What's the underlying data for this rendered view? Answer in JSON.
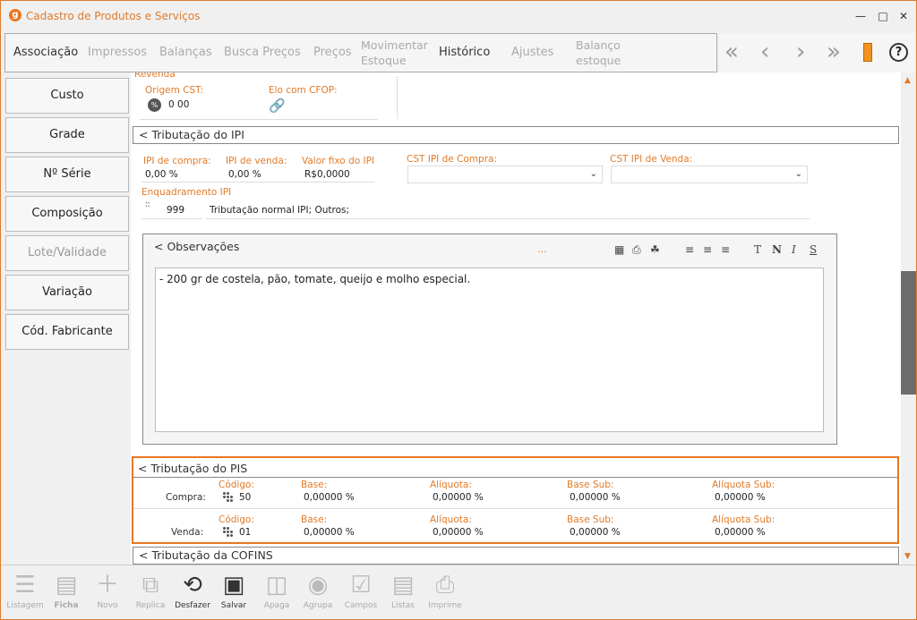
{
  "window": {
    "title": "Cadastro de Produtos e Serviços",
    "logo": "g"
  },
  "toolbar": {
    "tabs": [
      {
        "label": "Associação",
        "active": true
      },
      {
        "label": "Impressos",
        "active": false
      },
      {
        "label": "Balanças",
        "active": false
      },
      {
        "label": "Busca Preços",
        "active": false
      },
      {
        "label": "Preços",
        "active": false
      },
      {
        "label": "Movimentar Estoque",
        "active": false
      },
      {
        "label": "Histórico",
        "active": true
      },
      {
        "label": "Ajustes",
        "active": false
      },
      {
        "label": "Balanço estoque",
        "active": false
      }
    ],
    "help": "?"
  },
  "sidebar": {
    "items": [
      {
        "label": "Custo"
      },
      {
        "label": "Grade"
      },
      {
        "label": "Nº Série"
      },
      {
        "label": "Composição"
      },
      {
        "label": "Lote/Validade"
      },
      {
        "label": "Variação"
      },
      {
        "label": "Cód. Fabricante"
      }
    ]
  },
  "revenda": {
    "header": "Revenda",
    "origem_cst_label": "Origem CST:",
    "origem_cst_value": "0 00",
    "elo_cfop_label": "Elo com CFOP:"
  },
  "ipi": {
    "header": "< Tributação do IPI",
    "ipi_compra_label": "IPI de compra:",
    "ipi_compra_value": "0,00 %",
    "ipi_venda_label": "IPI de venda:",
    "ipi_venda_value": "0,00 %",
    "valor_fixo_label": "Valor fixo do IPI",
    "valor_fixo_value": "R$0,0000",
    "cst_compra_label": "CST IPI de Compra:",
    "cst_venda_label": "CST IPI de Venda:",
    "enquadramento_label": "Enquadramento IPI",
    "enquadramento_code": "999",
    "enquadramento_desc": "Tributação normal IPI; Outros;"
  },
  "observacoes": {
    "header": "< Observações",
    "ellipsis": "...",
    "text": "- 200 gr de costela, pão, tomate, queijo e molho especial."
  },
  "pis": {
    "header": "< Tributação do PIS",
    "rows": [
      {
        "label": "Compra:",
        "codigo_label": "Código:",
        "codigo": "50",
        "base_label": "Base:",
        "base": "0,00000 %",
        "aliquota_label": "Alíquota:",
        "aliquota": "0,00000 %",
        "base_sub_label": "Base Sub:",
        "base_sub": "0,00000 %",
        "aliquota_sub_label": "Alíquota Sub:",
        "aliquota_sub": "0,00000 %"
      },
      {
        "label": "Venda:",
        "codigo_label": "Código:",
        "codigo": "01",
        "base_label": "Base:",
        "base": "0,00000 %",
        "aliquota_label": "Alíquota:",
        "aliquota": "0,00000 %",
        "base_sub_label": "Base Sub:",
        "base_sub": "0,00000 %",
        "aliquota_sub_label": "Alíquota Sub:",
        "aliquota_sub": "0,00000 %"
      }
    ]
  },
  "cofins": {
    "header": "< Tributação da COFINS"
  },
  "bottom": {
    "items": [
      {
        "label": "Listagem",
        "icon": "list-icon",
        "on": false
      },
      {
        "label": "Ficha",
        "icon": "document-icon",
        "on": false
      },
      {
        "label": "Novo",
        "icon": "plus-icon",
        "on": false
      },
      {
        "label": "Replica",
        "icon": "copy-icon",
        "on": false
      },
      {
        "label": "Desfazer",
        "icon": "undo-icon",
        "on": true
      },
      {
        "label": "Salvar",
        "icon": "save-icon",
        "on": true
      },
      {
        "label": "Apaga",
        "icon": "trash-icon",
        "on": false
      },
      {
        "label": "Agrupa",
        "icon": "group-icon",
        "on": false
      },
      {
        "label": "Campos",
        "icon": "checklist-icon",
        "on": false
      },
      {
        "label": "Listas",
        "icon": "lists-icon",
        "on": false
      },
      {
        "label": "Imprime",
        "icon": "printer-icon",
        "on": false
      }
    ]
  },
  "colors": {
    "accent": "#e07b2a",
    "highlight_border": "#e87722",
    "scroll_thumb": "#6d6d6d"
  }
}
